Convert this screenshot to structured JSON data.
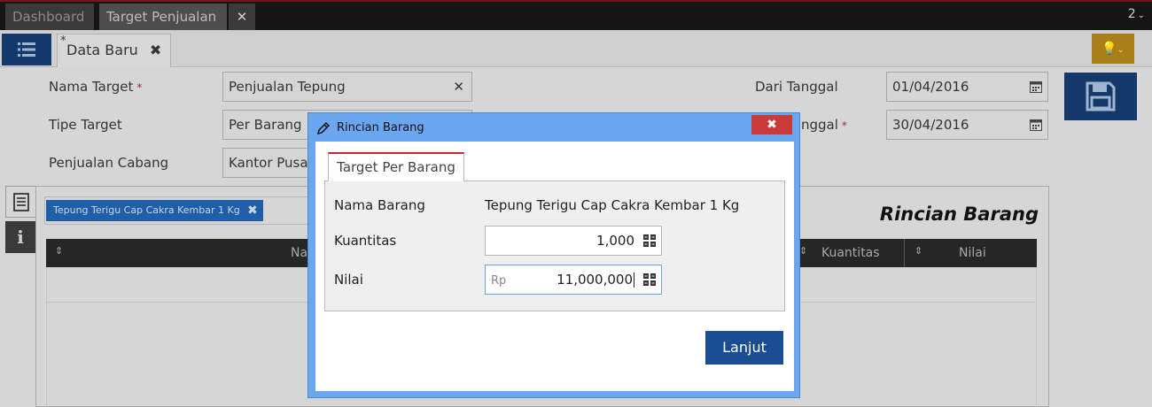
{
  "top_tabs": [
    {
      "label": "Dashboard"
    },
    {
      "label": "Target Penjualan"
    }
  ],
  "tab_count": "2",
  "doc_tab": {
    "marker": "*",
    "label": "Data Baru",
    "close": "✖"
  },
  "form": {
    "nama_target": {
      "label": "Nama Target",
      "required": "*",
      "value": "Penjualan Tepung"
    },
    "tipe_target": {
      "label": "Tipe Target",
      "value": "Per Barang"
    },
    "penjualan_cabang": {
      "label": "Penjualan Cabang",
      "value": "Kantor Pusat"
    },
    "dari_tanggal": {
      "label": "Dari Tanggal",
      "value": "01/04/2016"
    },
    "sampai_tanggal": {
      "label": "nggal",
      "required": "*",
      "value": "30/04/2016"
    }
  },
  "detail": {
    "chip_label": "Tepung Terigu Cap Cakra Kembar 1 Kg",
    "section_title": "Rincian Barang",
    "columns": [
      "Na",
      "Kuantitas",
      "Nilai"
    ]
  },
  "modal": {
    "title": "Rincian Barang",
    "close": "✖",
    "tab": "Target Per Barang",
    "nama_barang_label": "Nama Barang",
    "nama_barang_value": "Tepung Terigu Cap Cakra Kembar 1 Kg",
    "kuantitas_label": "Kuantitas",
    "kuantitas_value": "1,000",
    "nilai_label": "Nilai",
    "nilai_prefix": "Rp",
    "nilai_value": "11,000,000",
    "submit": "Lanjut"
  },
  "colors": {
    "accent_blue": "#13396b",
    "modal_border": "#6aa7f0",
    "close_red": "#c93b3b",
    "chip_blue": "#1f5ea8",
    "warning": "#a87f18"
  }
}
